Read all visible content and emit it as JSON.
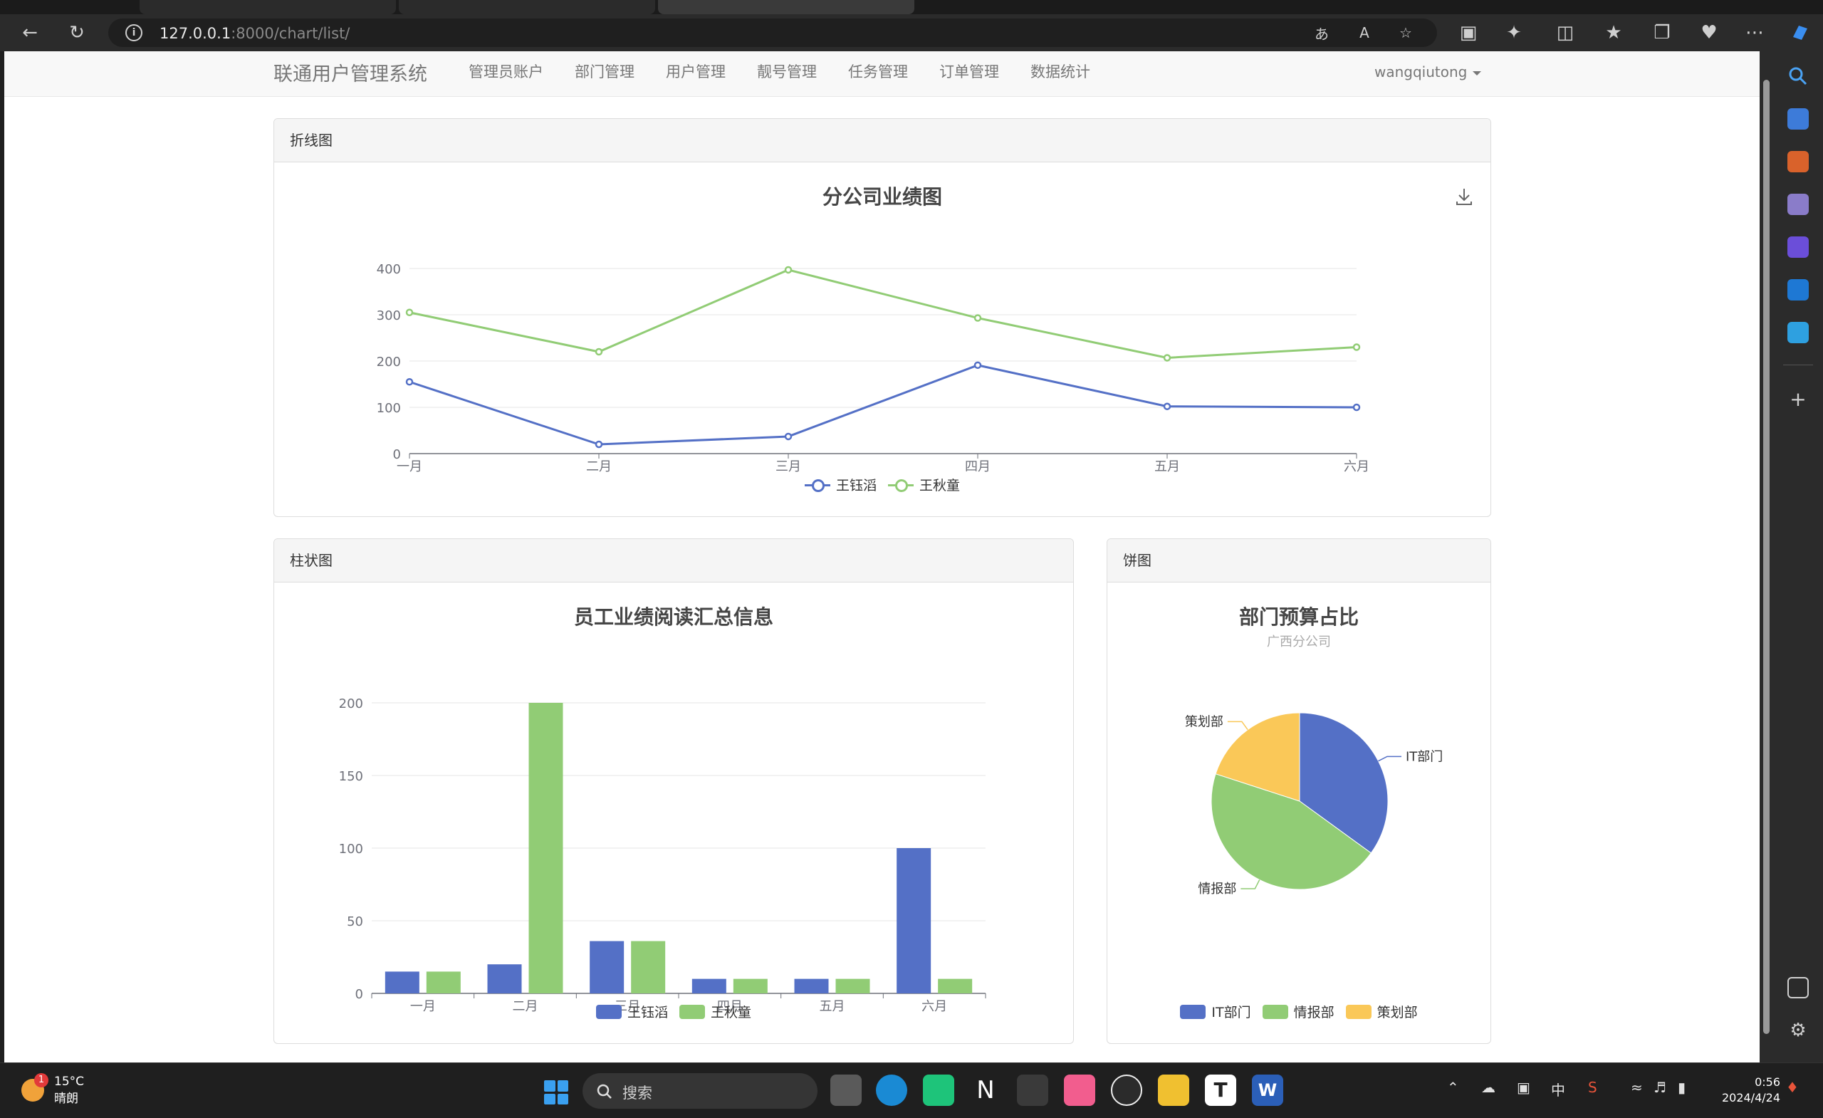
{
  "browser": {
    "url_host": "127.0.0.1",
    "url_rest": ":8000/chart/list/"
  },
  "navbar": {
    "brand": "联通用户管理系统",
    "items": [
      "管理员账户",
      "部门管理",
      "用户管理",
      "靓号管理",
      "任务管理",
      "订单管理",
      "数据统计"
    ],
    "user": "wangqiutong"
  },
  "panels": {
    "line": {
      "heading": "折线图",
      "chart_title": "分公司业绩图"
    },
    "bar": {
      "heading": "柱状图",
      "chart_title": "员工业绩阅读汇总信息"
    },
    "pie": {
      "heading": "饼图",
      "chart_title": "部门预算占比",
      "chart_subtitle": "广西分公司"
    }
  },
  "colors": {
    "blue": "#5470c6",
    "green": "#91cc75",
    "yellow": "#fac858"
  },
  "chart_data": [
    {
      "type": "line",
      "title": "分公司业绩图",
      "categories": [
        "一月",
        "二月",
        "三月",
        "四月",
        "五月",
        "六月"
      ],
      "series": [
        {
          "name": "王钰滔",
          "values": [
            155,
            20,
            37,
            191,
            102,
            100
          ]
        },
        {
          "name": "王秋童",
          "values": [
            305,
            220,
            397,
            293,
            207,
            230
          ]
        }
      ],
      "y_ticks": [
        "0",
        "100",
        "200",
        "300",
        "400"
      ],
      "ylim": [
        0,
        400
      ],
      "legend": "bottom",
      "grid": true
    },
    {
      "type": "bar",
      "title": "员工业绩阅读汇总信息",
      "categories": [
        "一月",
        "二月",
        "三月",
        "四月",
        "五月",
        "六月"
      ],
      "series": [
        {
          "name": "王钰滔",
          "values": [
            15,
            20,
            36,
            10,
            10,
            100
          ]
        },
        {
          "name": "王秋童",
          "values": [
            15,
            200,
            36,
            10,
            10,
            10
          ]
        }
      ],
      "y_ticks": [
        "0",
        "50",
        "100",
        "150",
        "200"
      ],
      "ylim": [
        0,
        200
      ],
      "legend": "bottom",
      "grid": true
    },
    {
      "type": "pie",
      "title": "部门预算占比",
      "subtitle": "广西分公司",
      "slices": [
        {
          "name": "IT部门",
          "value": 35
        },
        {
          "name": "情报部",
          "value": 45
        },
        {
          "name": "策划部",
          "value": 20
        }
      ],
      "legend": "bottom"
    }
  ],
  "taskbar": {
    "weather_temp": "15°C",
    "weather_desc": "晴朗",
    "weather_badge": "1",
    "search_label": "搜索",
    "ime": "中",
    "time": "0:56",
    "date": "2024/4/24"
  }
}
